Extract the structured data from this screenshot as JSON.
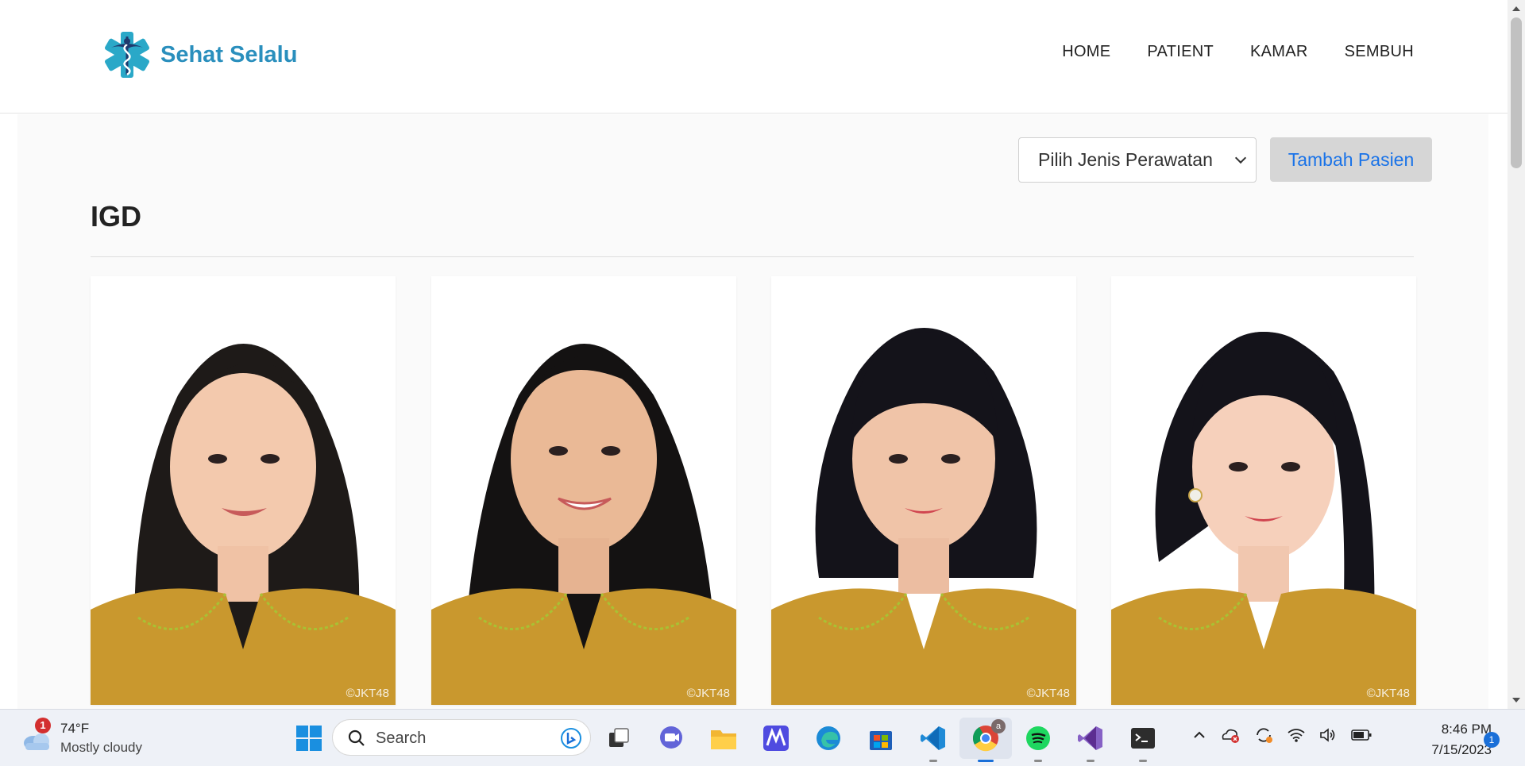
{
  "app": {
    "brand_name": "Sehat Selalu",
    "nav_items": [
      {
        "label": "HOME"
      },
      {
        "label": "PATIENT"
      },
      {
        "label": "KAMAR"
      },
      {
        "label": "SEMBUH"
      }
    ]
  },
  "toolbar": {
    "select_value": "Pilih Jenis Perawatan",
    "add_button_label": "Tambah Pasien"
  },
  "section": {
    "title": "IGD"
  },
  "cards": [
    {
      "watermark": "©JKT48"
    },
    {
      "watermark": "©JKT48"
    },
    {
      "watermark": "©JKT48"
    },
    {
      "watermark": "©JKT48"
    }
  ],
  "taskbar": {
    "weather_temp": "74°F",
    "weather_condition": "Mostly cloudy",
    "weather_badge": "1",
    "search_placeholder": "Search",
    "time": "8:46 PM",
    "date": "7/15/2023",
    "notification_count": "1",
    "chrome_badge": "a"
  },
  "colors": {
    "brand": "#2a8fbd",
    "accent": "#1a73e8"
  }
}
